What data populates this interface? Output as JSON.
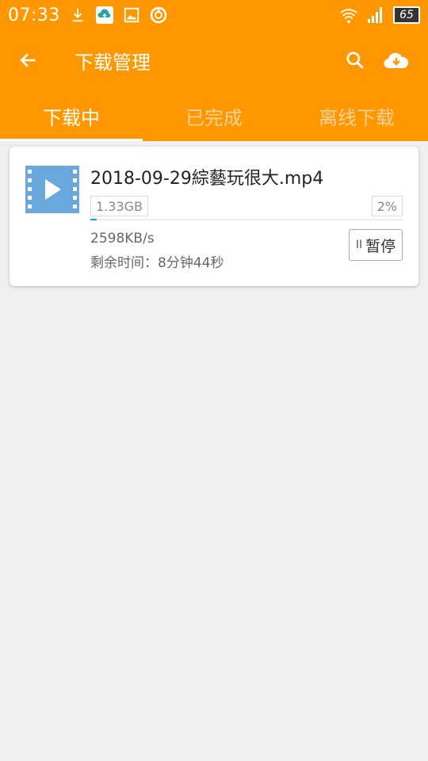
{
  "status_bar": {
    "time": "07:33",
    "battery": "65",
    "icons": [
      "usb-download-icon",
      "cloud-download-app-icon",
      "image-icon",
      "sync-icon",
      "wifi-icon",
      "signal-icon",
      "battery-icon"
    ]
  },
  "header": {
    "title": "下载管理",
    "accent_color": "#ff9800"
  },
  "tabs": [
    {
      "label": "下载中",
      "active": true
    },
    {
      "label": "已完成",
      "active": false
    },
    {
      "label": "离线下载",
      "active": false
    }
  ],
  "downloads": [
    {
      "filename": "2018-09-29綜藝玩很大.mp4",
      "size": "1.33GB",
      "percent": "2%",
      "progress": 0.02,
      "speed": "2598KB/s",
      "remaining": "剩余时间：8分钟44秒",
      "pause_label": "暂停",
      "icon": "video-file-icon"
    }
  ]
}
